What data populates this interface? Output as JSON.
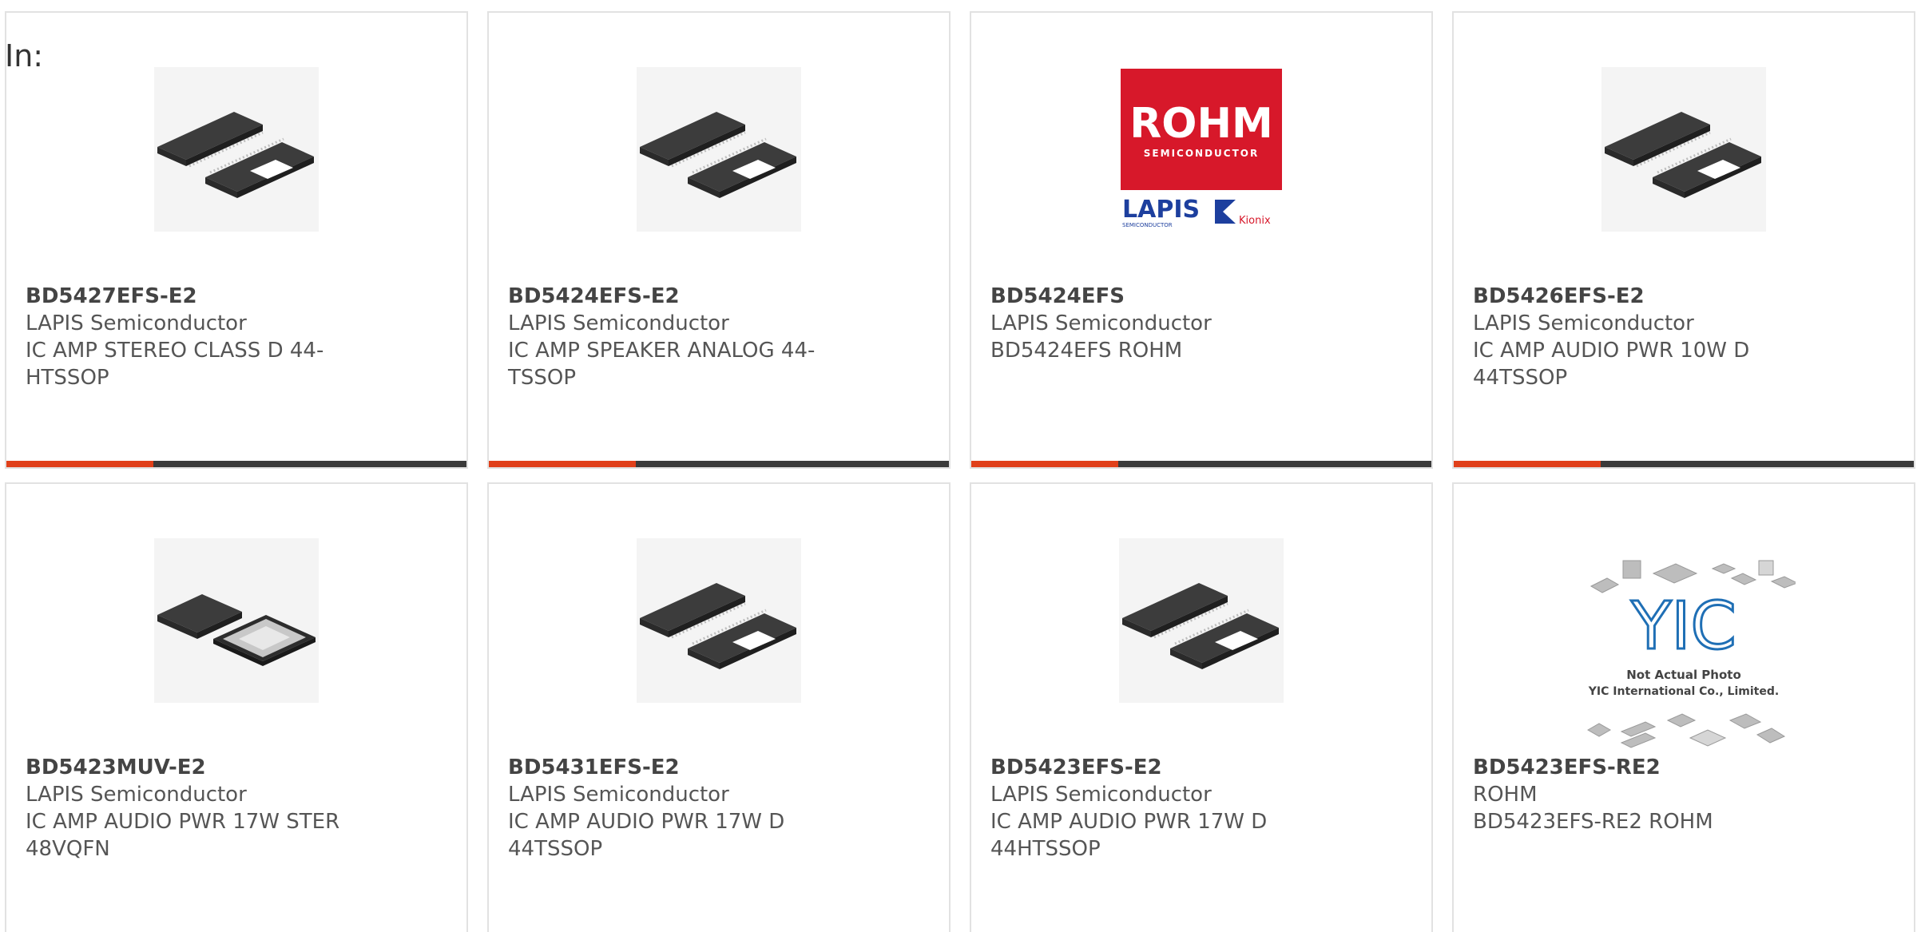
{
  "page": {
    "filter_label": "In:"
  },
  "colors": {
    "accent": "#e0401a",
    "bar_dark": "#3a3a3a",
    "rohm_red": "#d7182a",
    "lapis_blue": "#1d3f9e"
  },
  "products": [
    {
      "part_number": "BD5427EFS-E2",
      "manufacturer": "LAPIS Semiconductor",
      "description": "IC AMP STEREO CLASS D 44-HTSSOP",
      "image": "tssop-chip-icon"
    },
    {
      "part_number": "BD5424EFS-E2",
      "manufacturer": "LAPIS Semiconductor",
      "description": "IC AMP SPEAKER ANALOG 44-TSSOP",
      "image": "tssop-chip-icon"
    },
    {
      "part_number": "BD5424EFS",
      "manufacturer": "LAPIS Semiconductor",
      "description": "BD5424EFS ROHM",
      "image": "rohm-lapis-logo",
      "logo_text": {
        "rohm": "ROHM",
        "semiconductor": "SEMICONDUCTOR",
        "lapis": "LAPIS",
        "lapis_sub": "SEMICONDUCTOR",
        "kionix": "Kionix"
      }
    },
    {
      "part_number": "BD5426EFS-E2",
      "manufacturer": "LAPIS Semiconductor",
      "description": "IC AMP AUDIO PWR 10W D 44TSSOP",
      "image": "tssop-chip-icon"
    },
    {
      "part_number": "BD5423MUV-E2",
      "manufacturer": "LAPIS Semiconductor",
      "description": "IC AMP AUDIO PWR 17W STER 48VQFN",
      "image": "vqfn-chip-icon"
    },
    {
      "part_number": "BD5431EFS-E2",
      "manufacturer": "LAPIS Semiconductor",
      "description": "IC AMP AUDIO PWR 17W D 44TSSOP",
      "image": "tssop-chip-icon"
    },
    {
      "part_number": "BD5423EFS-E2",
      "manufacturer": "LAPIS Semiconductor",
      "description": "IC AMP AUDIO PWR 17W D 44HTSSOP",
      "image": "tssop-chip-icon"
    },
    {
      "part_number": "BD5423EFS-RE2",
      "manufacturer": "ROHM",
      "description": "BD5423EFS-RE2 ROHM",
      "image": "yic-placeholder-icon",
      "placeholder_text": {
        "logo": "YIC",
        "line1": "Not Actual Photo",
        "line2": "YIC International Co., Limited."
      }
    }
  ]
}
